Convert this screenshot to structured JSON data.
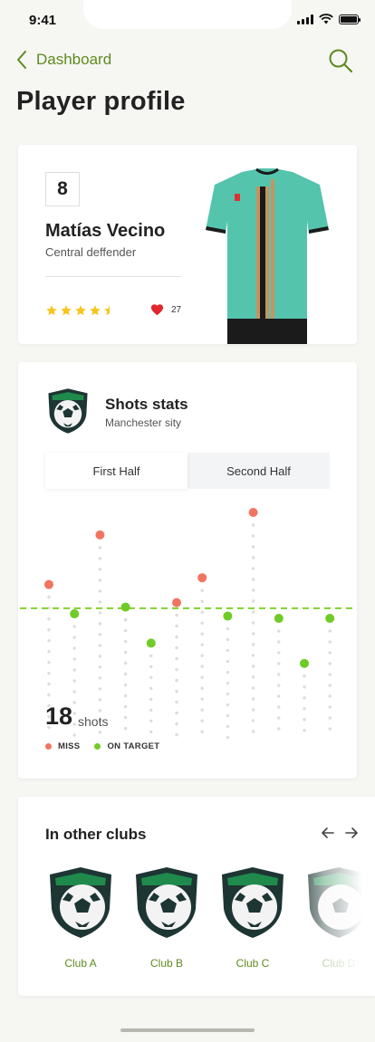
{
  "status": {
    "time": "9:41"
  },
  "nav": {
    "back_label": "Dashboard"
  },
  "page": {
    "title": "Player profile"
  },
  "player": {
    "number": "8",
    "name": "Matías Vecino",
    "position": "Central deffender",
    "rating": 4.5,
    "likes": "27"
  },
  "shots": {
    "title": "Shots stats",
    "team": "Manchester sity",
    "tabs": [
      "First Half",
      "Second Half"
    ],
    "active_tab": 0,
    "count": "18",
    "unit": "shots",
    "legend_miss": "MISS",
    "legend_on_target": "ON TARGET"
  },
  "chart_data": {
    "type": "scatter",
    "series": [
      {
        "name": "MISS",
        "color": "#f07560",
        "values": [
          0.68,
          null,
          0.9,
          null,
          null,
          0.6,
          0.71,
          null,
          1.0,
          null,
          null,
          null
        ]
      },
      {
        "name": "ON TARGET",
        "color": "#6fcc26",
        "values": [
          null,
          0.55,
          null,
          0.58,
          0.42,
          null,
          null,
          0.54,
          null,
          0.53,
          0.33,
          0.53
        ]
      }
    ],
    "average": 0.575
  },
  "clubs": {
    "title": "In other clubs",
    "items": [
      "Club A",
      "Club B",
      "Club C",
      "Club D"
    ]
  },
  "colors": {
    "accent": "#5d8a1e",
    "miss": "#f07560",
    "on_target": "#6fcc26",
    "crest_green": "#1f8a4c",
    "crest_dark": "#1d3533"
  }
}
